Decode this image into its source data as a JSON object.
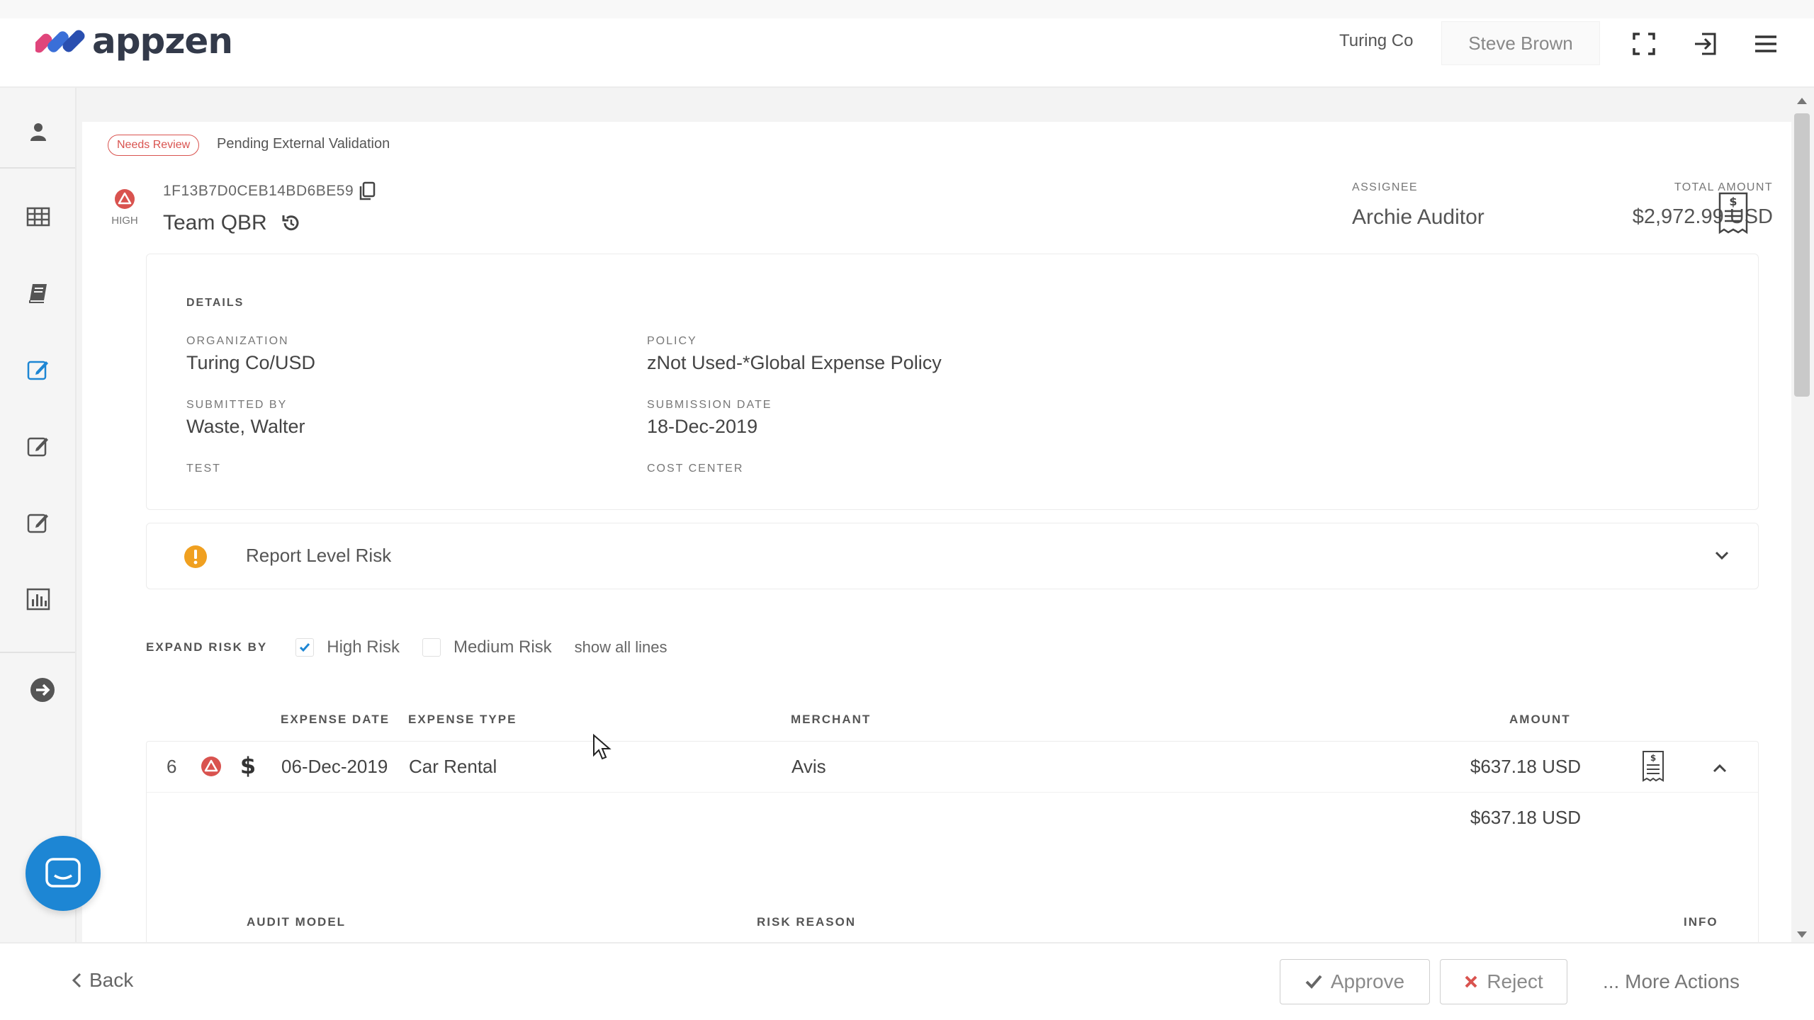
{
  "header": {
    "logo_text": "appzen",
    "org_name": "Turing Co",
    "user_name": "Steve Brown",
    "icons": [
      "fullscreen-icon",
      "logout-icon",
      "menu-icon"
    ]
  },
  "sidebar": {
    "items": [
      {
        "icon": "user-icon"
      },
      {
        "icon": "table-icon"
      },
      {
        "icon": "book-icon"
      },
      {
        "icon": "edit-active-icon"
      },
      {
        "icon": "edit-icon"
      },
      {
        "icon": "edit-alt-icon"
      },
      {
        "icon": "bar-chart-icon"
      },
      {
        "icon": "arrow-right-circle-icon"
      }
    ],
    "active_color": "#1d86d4"
  },
  "report": {
    "status_badge": "Needs Review",
    "status_text": "Pending External Validation",
    "risk_label": "HIGH",
    "report_id": "1F13B7D0CEB14BD6BE59",
    "title": "Team QBR",
    "assignee_label": "ASSIGNEE",
    "assignee": "Archie Auditor",
    "total_label": "TOTAL AMOUNT",
    "total_amount": "$2,972.99 USD"
  },
  "details": {
    "title": "DETAILS",
    "organization_label": "ORGANIZATION",
    "organization": "Turing Co/USD",
    "policy_label": "POLICY",
    "policy": "zNot Used-*Global Expense Policy",
    "submitted_by_label": "SUBMITTED BY",
    "submitted_by": "Waste, Walter",
    "submission_date_label": "SUBMISSION DATE",
    "submission_date": "18-Dec-2019",
    "test_label": "TEST",
    "cost_center_label": "COST CENTER"
  },
  "report_risk": {
    "title": "Report Level Risk"
  },
  "expand_risk": {
    "label": "EXPAND RISK BY",
    "high_risk": "High Risk",
    "high_risk_checked": true,
    "medium_risk": "Medium Risk",
    "medium_risk_checked": false,
    "show_all": "show all lines"
  },
  "columns": {
    "expense_date": "EXPENSE DATE",
    "expense_type": "EXPENSE TYPE",
    "merchant": "MERCHANT",
    "amount": "AMOUNT"
  },
  "lines": [
    {
      "index": "6",
      "date": "06-Dec-2019",
      "type": "Car Rental",
      "merchant": "Avis",
      "amount": "$637.18 USD",
      "subtotal": "$637.18 USD"
    }
  ],
  "audit_columns": {
    "audit_model": "AUDIT MODEL",
    "risk_reason": "RISK REASON",
    "info": "INFO"
  },
  "footer": {
    "back": "Back",
    "approve": "Approve",
    "reject": "Reject",
    "more_actions": "... More Actions"
  },
  "colors": {
    "danger": "#d9534f",
    "warning": "#f0a020",
    "accent": "#1d86d4"
  }
}
